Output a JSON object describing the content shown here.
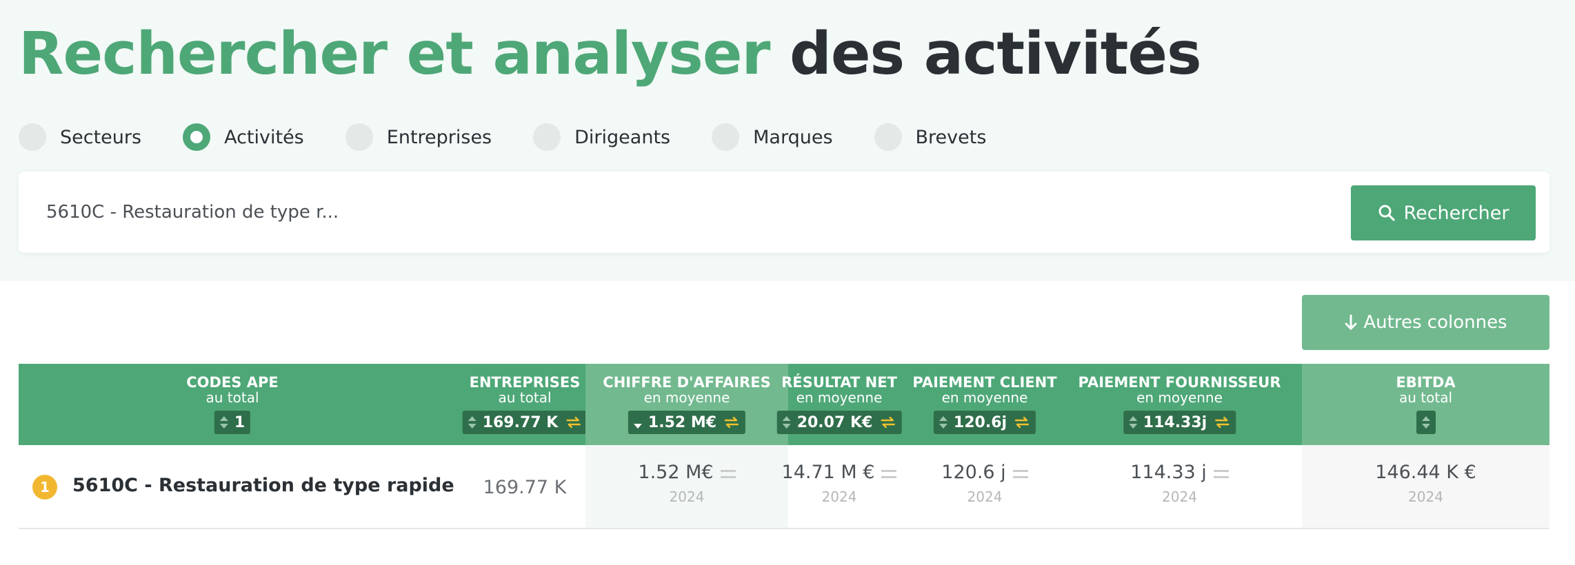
{
  "header": {
    "title_green": "Rechercher et analyser",
    "title_dark": "des activités"
  },
  "search_types": [
    {
      "label": "Secteurs",
      "selected": false
    },
    {
      "label": "Activités",
      "selected": true
    },
    {
      "label": "Entreprises",
      "selected": false
    },
    {
      "label": "Dirigeants",
      "selected": false
    },
    {
      "label": "Marques",
      "selected": false
    },
    {
      "label": "Brevets",
      "selected": false
    }
  ],
  "search": {
    "value": "5610C - Restauration de type r...",
    "button_label": "Rechercher"
  },
  "autres_colonnes_label": "Autres colonnes",
  "table": {
    "columns": [
      {
        "title": "CODES APE",
        "subtitle": "au total",
        "pill": "1"
      },
      {
        "title": "ENTREPRISES",
        "subtitle": "au total",
        "pill": "169.77 K"
      },
      {
        "title": "CHIFFRE D'AFFAIRES",
        "subtitle": "en moyenne",
        "pill": "1.52 M€"
      },
      {
        "title": "RÉSULTAT NET",
        "subtitle": "en moyenne",
        "pill": "20.07 K€"
      },
      {
        "title": "PAIEMENT CLIENT",
        "subtitle": "en moyenne",
        "pill": "120.6j"
      },
      {
        "title": "PAIEMENT FOURNISSEUR",
        "subtitle": "en moyenne",
        "pill": "114.33j"
      },
      {
        "title": "EBITDA",
        "subtitle": "au total",
        "pill": ""
      }
    ],
    "rows": [
      {
        "rank": "1",
        "code": "5610C - Restauration de type rapide",
        "entreprises": "169.77 K",
        "chiffre_affaires": {
          "value": "1.52 M€",
          "year": "2024"
        },
        "resultat_net": {
          "value": "14.71 M €",
          "year": "2024"
        },
        "paiement_client": {
          "value": "120.6 j",
          "year": "2024"
        },
        "paiement_fournisseur": {
          "value": "114.33 j",
          "year": "2024"
        },
        "ebitda": {
          "value": "146.44 K €",
          "year": "2024"
        }
      }
    ]
  },
  "colors": {
    "green": "#4ea777",
    "green_light": "#72b98f",
    "pill_dark": "#2f6e4a",
    "swap_icon": "#f2c12e",
    "rank_badge": "#f2b731",
    "hero_bg": "#f2f9f6"
  }
}
